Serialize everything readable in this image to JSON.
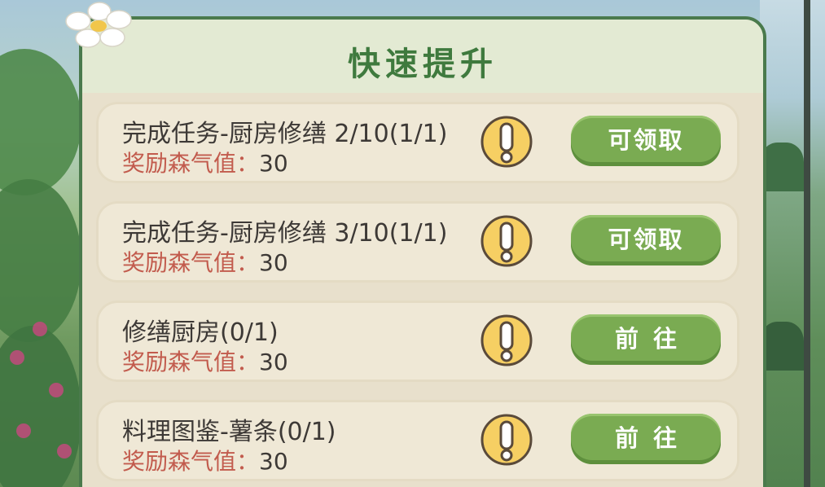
{
  "panel": {
    "title": "快速提升"
  },
  "tasks": [
    {
      "title": "完成任务-厨房修缮 2/10(1/1)",
      "reward_label": "奖励森气值：",
      "reward_value": "30",
      "button_label": "可领取"
    },
    {
      "title": "完成任务-厨房修缮 3/10(1/1)",
      "reward_label": "奖励森气值：",
      "reward_value": "30",
      "button_label": "可领取"
    },
    {
      "title": "修缮厨房(0/1)",
      "reward_label": "奖励森气值：",
      "reward_value": "30",
      "button_label": "前往"
    },
    {
      "title": "料理图鉴-薯条(0/1)",
      "reward_label": "奖励森气值：",
      "reward_value": "30",
      "button_label": "前往"
    }
  ],
  "icons": {
    "alert": "exclamation-circle-icon",
    "decoration": "daisy-flower-icon"
  },
  "colors": {
    "title_green": "#3f7a3e",
    "button_green": "#7aab52",
    "reward_red": "#c25b4d",
    "alert_yellow": "#f6cf63",
    "panel_bg": "#e8e0cc"
  }
}
